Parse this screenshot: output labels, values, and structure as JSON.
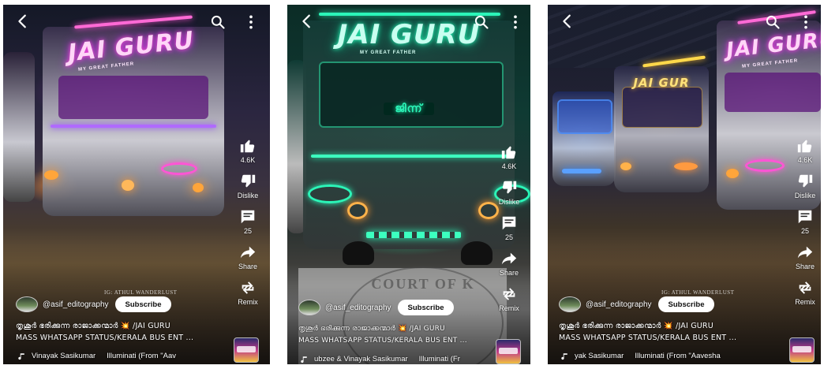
{
  "screens": [
    {
      "bus_logo": "JAI GURU",
      "bus_logo_sub": "MY GREAT FATHER",
      "likes": "4.6K",
      "dislike_label": "Dislike",
      "comments": "25",
      "share_label": "Share",
      "remix_label": "Remix",
      "watermark": "IG: ATHUL WANDERLUST",
      "channel_handle": "@asif_editography",
      "subscribe_label": "Subscribe",
      "title_line1": "തൃശൂർ ഭരിക്കുന്ന രാജാക്കന്മാർ 💥 /JAI GURU",
      "title_line2": "MASS WHATSAPP STATUS/KERALA BUS ENT ...",
      "music_artist": "Vinayak Sasikumar",
      "music_track": "Illuminati (From \"Aav"
    },
    {
      "bus_logo": "JAI GURU",
      "bus_logo_sub": "MY GREAT FATHER",
      "bus_badge": "ജിന്ന്",
      "likes": "4.6K",
      "dislike_label": "Dislike",
      "comments": "25",
      "share_label": "Share",
      "remix_label": "Remix",
      "court_text": "COURT OF K",
      "channel_handle": "@asif_editography",
      "subscribe_label": "Subscribe",
      "title_line1": "തൃശൂർ ഭരിക്കുന്ന രാജാക്കന്മാർ 💥 /JAI GURU",
      "title_line2": "MASS WHATSAPP STATUS/KERALA BUS ENT ...",
      "music_artist": "ubzee & Vinayak Sasikumar",
      "music_track": "Illuminati (Fr"
    },
    {
      "bus_logo": "JAI GURU",
      "bus_logo_sub": "MY GREAT FATHER",
      "bus2_logo": "JAI GUR",
      "likes": "4.6K",
      "dislike_label": "Dislike",
      "comments": "25",
      "share_label": "Share",
      "remix_label": "Remix",
      "watermark": "IG: ATHUL WANDERLUST",
      "channel_handle": "@asif_editography",
      "subscribe_label": "Subscribe",
      "title_line1": "തൃശൂർ ഭരിക്കുന്ന രാജാക്കന്മാർ 💥 /JAI GURU",
      "title_line2": "MASS WHATSAPP STATUS/KERALA BUS ENT ...",
      "music_artist": "yak Sasikumar",
      "music_track": "Illuminati (From \"Aavesha"
    }
  ],
  "colors": {
    "subscribe_bg": "#ffffff",
    "subscribe_text": "#0f0f0f",
    "neon_pink": "#ff4fd8",
    "neon_green": "#2bf5b8"
  }
}
